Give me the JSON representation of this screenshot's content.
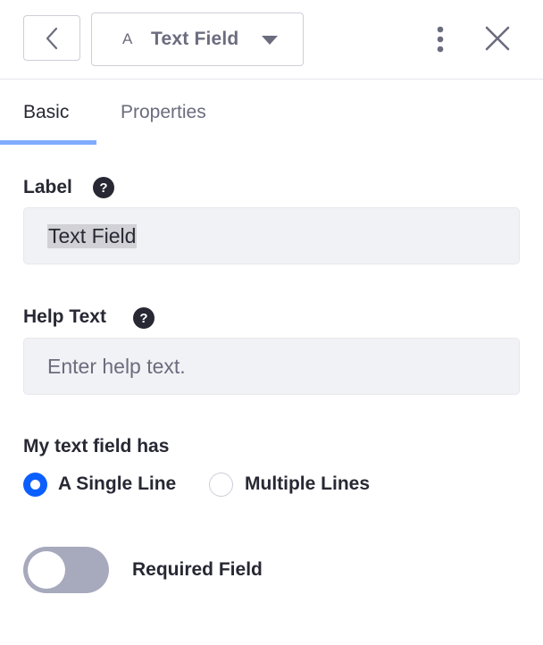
{
  "header": {
    "back_icon": "chevron-left-icon",
    "field_type": {
      "icon_glyph": "A",
      "label": "Text Field",
      "dropdown_icon": "caret-down-icon"
    },
    "more_icon": "kebab-vertical-icon",
    "close_icon": "close-icon"
  },
  "tabs": [
    {
      "label": "Basic",
      "active": true
    },
    {
      "label": "Properties",
      "active": false
    }
  ],
  "fields": {
    "label": {
      "title": "Label",
      "help_glyph": "?",
      "value": "Text Field"
    },
    "help_text": {
      "title": "Help Text",
      "help_glyph": "?",
      "placeholder": "Enter help text."
    }
  },
  "line_option": {
    "title": "My text field has",
    "options": [
      {
        "label": "A Single Line",
        "checked": true
      },
      {
        "label": "Multiple Lines",
        "checked": false
      }
    ]
  },
  "required": {
    "label": "Required Field",
    "on": false
  },
  "colors": {
    "accent": "#0b5fff",
    "tab_indicator": "#80acff",
    "text": "#272833",
    "muted": "#6b6c7e"
  }
}
